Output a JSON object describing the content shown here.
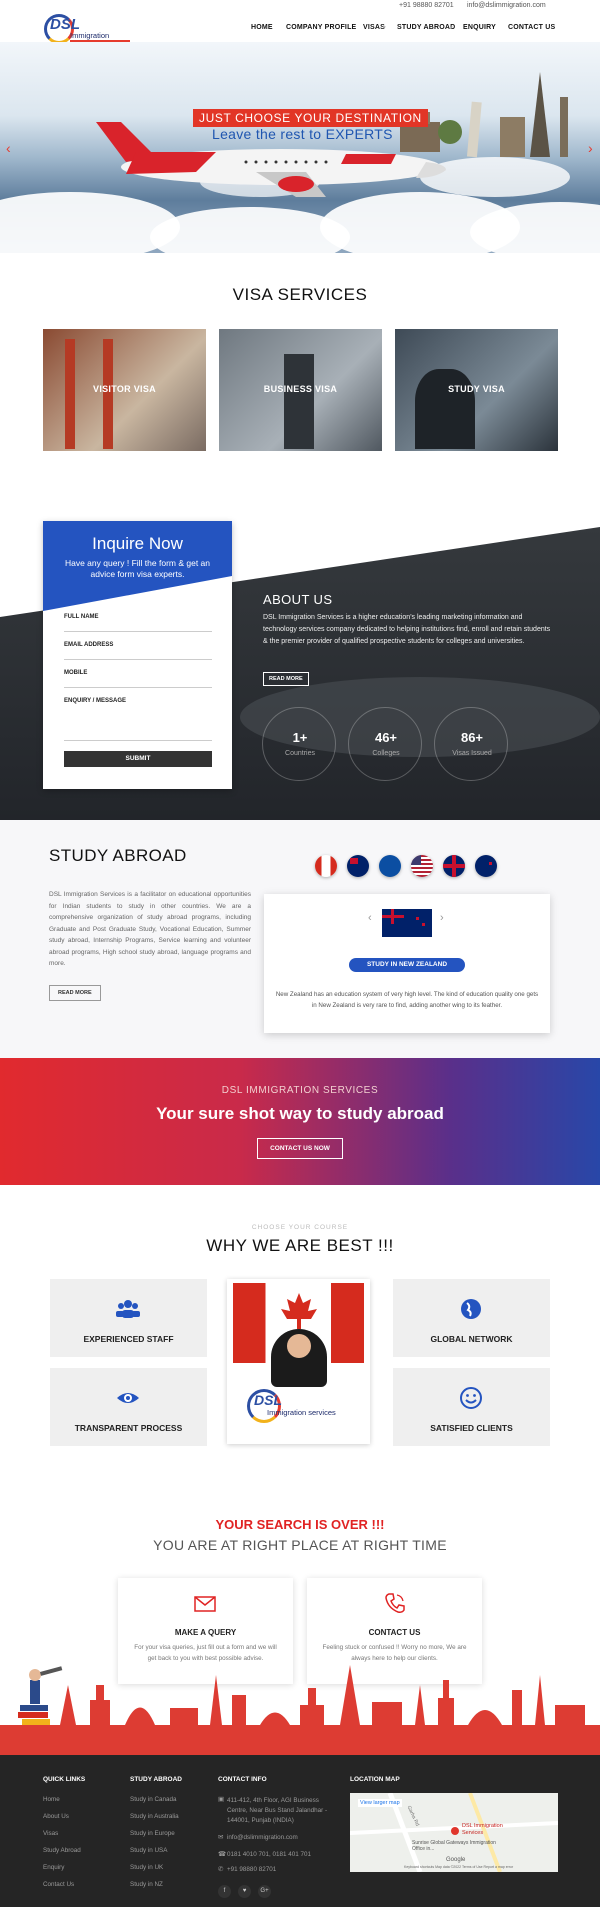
{
  "topbar": {
    "phone": "+91 98880 82701",
    "email": "info@dslimmigration.com"
  },
  "brand": {
    "logo_text": "DSL",
    "logo_sub": "Immigration services",
    "accent": "#e63b2e",
    "blue": "#2454c0"
  },
  "nav": [
    "HOME",
    "COMPANY PROFILE",
    "VISAS",
    "STUDY ABROAD",
    "ENQUIRY",
    "CONTACT US"
  ],
  "hero": {
    "line1": "JUST CHOOSE YOUR DESTINATION",
    "line2": "Leave the rest to EXPERTS",
    "prev_icon": "chevron-left-icon",
    "next_icon": "chevron-right-icon"
  },
  "visa": {
    "title": "VISA SERVICES",
    "cards": [
      "VISITOR VISA",
      "BUSINESS VISA",
      "STUDY VISA"
    ]
  },
  "inquire": {
    "title": "Inquire Now",
    "subtitle": "Have any query ! Fill the form & get an advice form visa experts.",
    "fields": [
      "FULL NAME",
      "EMAIL ADDRESS",
      "MOBILE",
      "ENQUIRY / MESSAGE"
    ],
    "submit": "SUBMIT"
  },
  "about": {
    "title": "ABOUT US",
    "text": "DSL Immigration Services is a higher education's leading marketing information and technology services company dedicated to helping institutions find, enroll and retain students & the premier provider of qualified prospective students for colleges and universities.",
    "read_more": "READ MORE",
    "stats": [
      {
        "num": "1+",
        "label": "Countries"
      },
      {
        "num": "46+",
        "label": "Colleges"
      },
      {
        "num": "86+",
        "label": "Visas Issued"
      }
    ]
  },
  "study": {
    "title": "STUDY ABROAD",
    "text": "DSL Immigration Services is a facilitator on educational opportunities for Indian students to study in other countries. We are a comprehensive organization of study abroad programs, including Graduate and Post Graduate Study, Vocational Education, Summer study abroad, Internship Programs, Service learning and volunteer abroad programs, High school study abroad, language programs and more.",
    "read_more": "READ MORE",
    "button": "STUDY IN NEW ZEALAND",
    "note": "New Zealand has an education system of very high level. The kind of education quality one gets in New Zealand is very rare to find, adding another wing to its feather."
  },
  "band": {
    "small": "DSL IMMIGRATION SERVICES",
    "big": "Your sure shot way to study abroad",
    "button": "CONTACT US NOW"
  },
  "why": {
    "kicker": "CHOOSE YOUR COURSE",
    "title": "WHY WE ARE BEST !!!",
    "items": [
      "EXPERIENCED STAFF",
      "GLOBAL NETWORK",
      "TRANSPARENT PROCESS",
      "SATISFIED CLIENTS"
    ],
    "logo_text": "DSL",
    "logo_sub": "Immigration services"
  },
  "search": {
    "title": "YOUR SEARCH IS OVER !!!",
    "subtitle": "YOU ARE AT RIGHT PLACE AT RIGHT TIME",
    "cards": [
      {
        "title": "MAKE A QUERY",
        "desc": "For your visa queries, just fill out a form and we will get back to you with best possible advise."
      },
      {
        "title": "CONTACT US",
        "desc": "Feeling stuck or confused !! Worry no more, We are always here to help our clients."
      }
    ]
  },
  "footer": {
    "quick_title": "QUICK LINKS",
    "quick": [
      "Home",
      "About Us",
      "Visas",
      "Study Abroad",
      "Enquiry",
      "Contact Us"
    ],
    "study_title": "STUDY ABROAD",
    "study": [
      "Study in Canada",
      "Study in Australia",
      "Study in Europe",
      "Study in USA",
      "Study in UK",
      "Study in NZ"
    ],
    "contact_title": "CONTACT INFO",
    "address": "411-412, 4th Floor, AGI Business Centre, Near Bus Stand Jalandhar - 144001, Punjab (INDIA)",
    "email": "info@dslimmigration.com",
    "phones": "0181 4010 701, 0181 401 701",
    "mobile": "+91 98880 82701",
    "map_title": "LOCATION MAP",
    "map_link": "View larger map",
    "map_place": "DSL Immigration Services",
    "map_place2": "Sunrise Global Gateways Immigration Office in...",
    "map_road": "Garha Rd",
    "map_footer": "Keyboard shortcuts  Map data ©2022  Terms of Use  Report a map error",
    "map_google": "Google",
    "social": [
      "f",
      "♥",
      "G+"
    ]
  }
}
